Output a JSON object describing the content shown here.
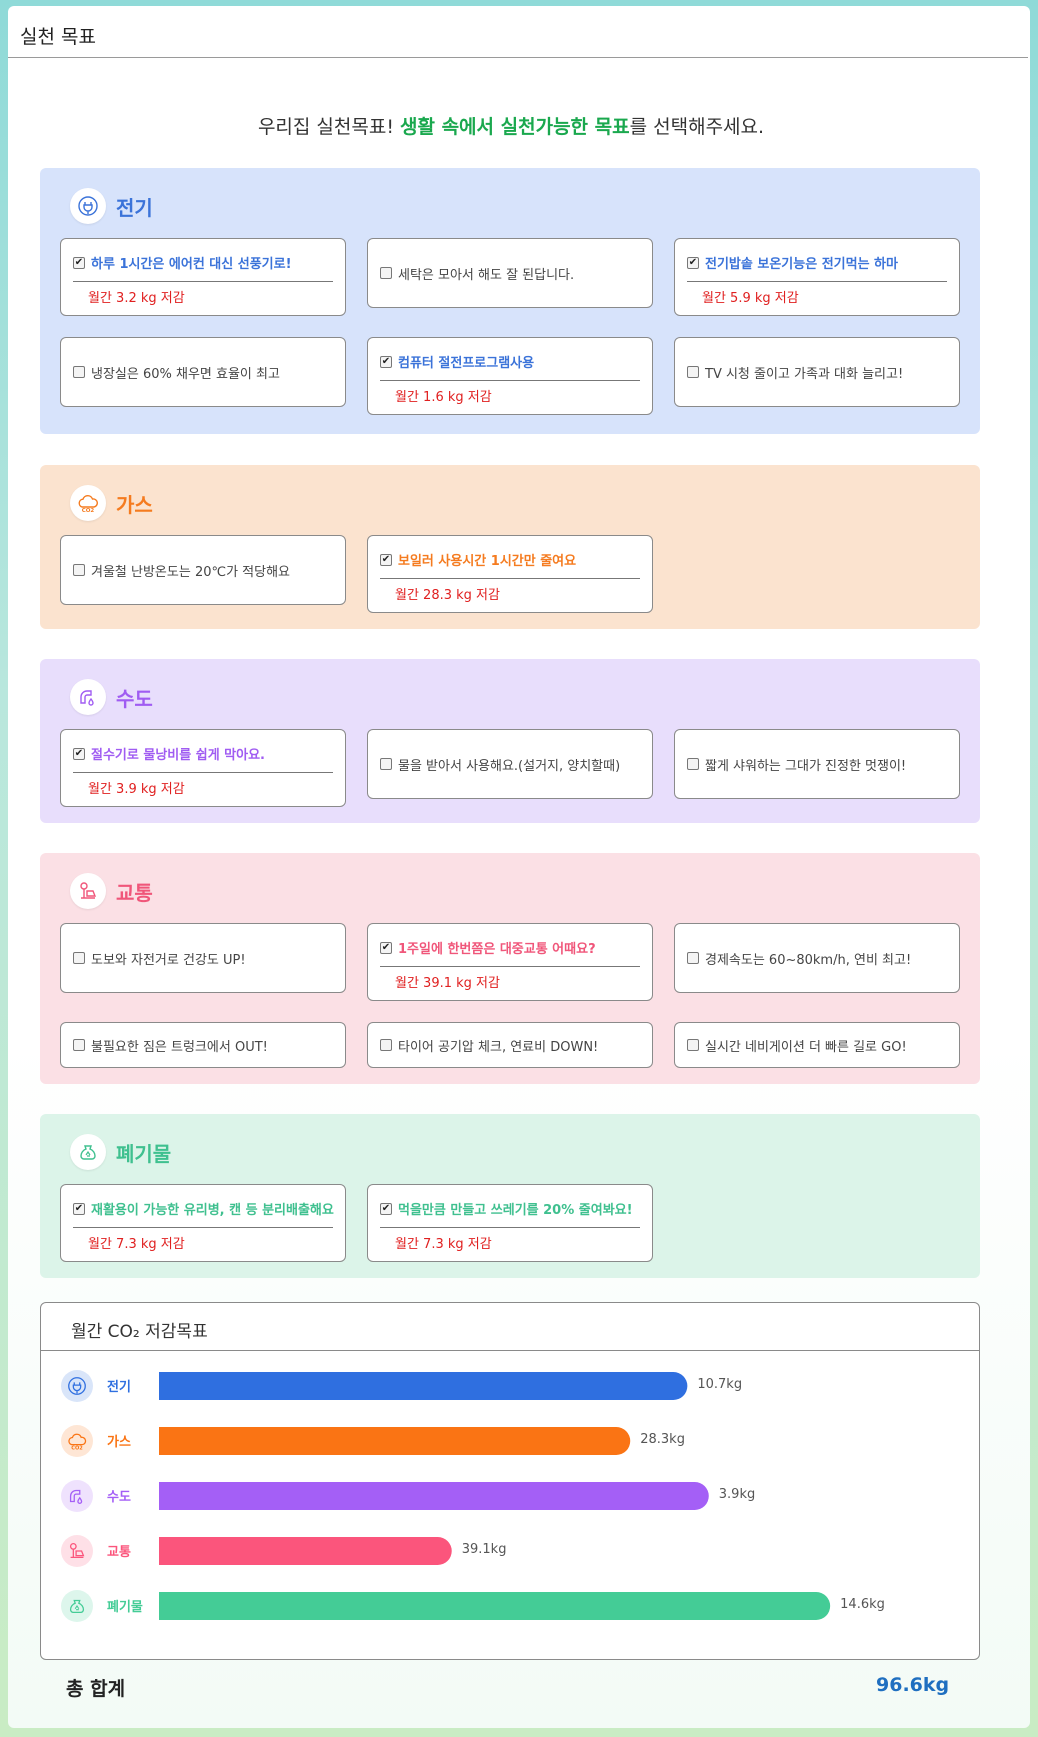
{
  "page_title": "실천 목표",
  "intro": {
    "pre": "우리집 실천목표! ",
    "highlight": "생활 속에서 실천가능한 목표",
    "post": "를 선택해주세요."
  },
  "sections": [
    {
      "name": "전기",
      "icon": "plug-icon",
      "color": "#3b73d9",
      "bg": "#d7e3fb",
      "items": [
        {
          "label": "하루 1시간은 에어컨 대신 선풍기로!",
          "checked": true,
          "saving": "월간 3.2 kg 저감"
        },
        {
          "label": "세탁은 모아서 해도 잘 된답니다.",
          "checked": false
        },
        {
          "label": "전기밥솥 보온기능은 전기먹는 하마",
          "checked": true,
          "saving": "월간 5.9 kg 저감"
        },
        {
          "label": "냉장실은 60% 채우면 효율이 최고",
          "checked": false
        },
        {
          "label": "컴퓨터 절전프로그램사용",
          "checked": true,
          "saving": "월간 1.6 kg 저감"
        },
        {
          "label": "TV 시청 줄이고 가족과 대화 늘리고!",
          "checked": false
        }
      ]
    },
    {
      "name": "가스",
      "icon": "co2-cloud-icon",
      "color": "#f57b1f",
      "bg": "#fbe3cf",
      "items": [
        {
          "label": "겨울철 난방온도는 20℃가 적당해요",
          "checked": false
        },
        {
          "label": "보일러 사용시간 1시간만 줄여요",
          "checked": true,
          "saving": "월간 28.3 kg 저감"
        }
      ]
    },
    {
      "name": "수도",
      "icon": "faucet-icon",
      "color": "#a05cf2",
      "bg": "#e8defc",
      "items": [
        {
          "label": "절수기로 물낭비를 쉽게 막아요.",
          "checked": true,
          "saving": "월간 3.9 kg 저감"
        },
        {
          "label": "물을 받아서 사용해요.(설거지, 양치할때)",
          "checked": false
        },
        {
          "label": "짧게 샤워하는 그대가 진정한 멋쟁이!",
          "checked": false
        }
      ]
    },
    {
      "name": "교통",
      "icon": "traffic-icon",
      "color": "#f0567a",
      "bg": "#fbe0e5",
      "items": [
        {
          "label": "도보와 자전거로 건강도 UP!",
          "checked": false
        },
        {
          "label": "1주일에 한번쯤은 대중교통 어때요?",
          "checked": true,
          "saving": "월간 39.1 kg 저감"
        },
        {
          "label": "경제속도는 60~80km/h, 연비 최고!",
          "checked": false
        },
        {
          "label": "불필요한 짐은 트렁크에서 OUT!",
          "checked": false
        },
        {
          "label": "타이어 공기압 체크, 연료비 DOWN!",
          "checked": false
        },
        {
          "label": "실시간 네비게이션 더 빠른 길로 GO!",
          "checked": false
        }
      ]
    },
    {
      "name": "폐기물",
      "icon": "recycle-bag-icon",
      "color": "#3fc08f",
      "bg": "#dcf4e9",
      "items": [
        {
          "label": "재활용이 가능한 유리병, 캔 등 분리배출해요",
          "checked": true,
          "saving": "월간 7.3 kg 저감"
        },
        {
          "label": "먹을만큼 만들고 쓰레기를 20% 줄여봐요!",
          "checked": true,
          "saving": "월간 7.3 kg 저감"
        }
      ]
    }
  ],
  "chart_title": "월간 CO₂  저감목표",
  "chart_data": {
    "type": "bar",
    "orientation": "horizontal",
    "title": "월간 CO₂  저감목표",
    "categories": [
      "전기",
      "가스",
      "수도",
      "교통",
      "폐기물"
    ],
    "value_labels": [
      "10.7kg",
      "28.3kg",
      "3.9kg",
      "39.1kg",
      "14.6kg"
    ],
    "bar_fill": [
      0.74,
      0.66,
      0.77,
      0.41,
      0.94
    ],
    "colors": [
      "#2f6fe0",
      "#fa7414",
      "#a45ff6",
      "#fb557c",
      "#44cc96"
    ],
    "icons": [
      "plug-icon",
      "co2-cloud-icon",
      "faucet-icon",
      "traffic-icon",
      "recycle-bag-icon"
    ]
  },
  "total": {
    "label": "총 합계",
    "value": "96.6kg"
  }
}
